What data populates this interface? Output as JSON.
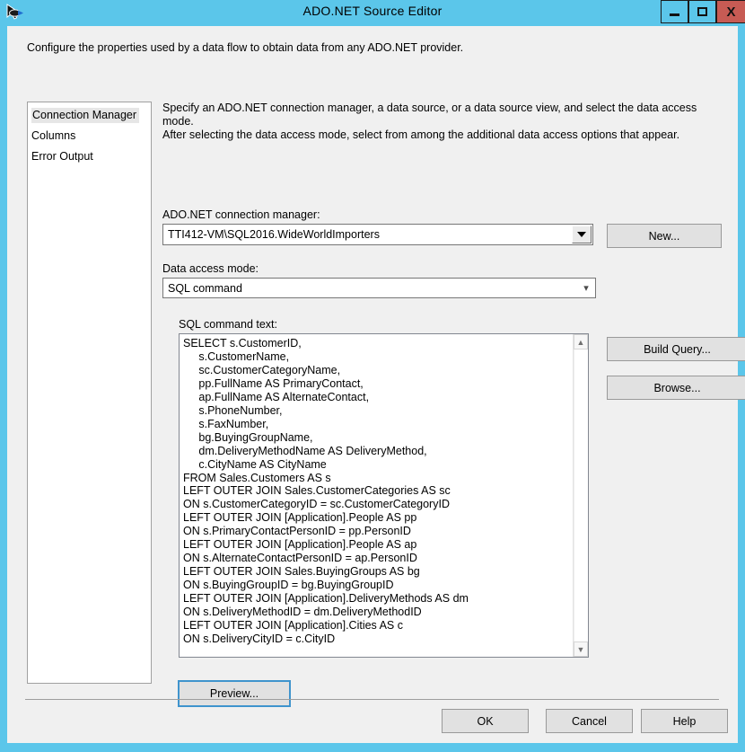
{
  "window": {
    "title": "ADO.NET Source Editor",
    "icon": "ado-net-source-icon",
    "controls": {
      "minimize": "minimize-icon",
      "maximize": "maximize-icon",
      "close": "X"
    },
    "colors": {
      "titlebar": "#5bc6ea",
      "dialog_background": "#f0f0f0",
      "close_button": "#c75b54",
      "focus_outline": "#3f94cd"
    }
  },
  "header": {
    "description": "Configure the properties used by a data flow to obtain data from any ADO.NET provider."
  },
  "nav": {
    "items": [
      {
        "label": "Connection Manager",
        "selected": true
      },
      {
        "label": "Columns",
        "selected": false
      },
      {
        "label": "Error Output",
        "selected": false
      }
    ]
  },
  "content": {
    "description_line1": "Specify an ADO.NET connection manager, a data source, or a data source view, and select the data access mode.",
    "description_line2": "After selecting the data access mode, select from among the additional data access options that appear.",
    "connection_manager": {
      "label": "ADO.NET connection manager:",
      "value": "TTI412-VM\\SQL2016.WideWorldImporters",
      "arrow_icon": "triangle-down-icon",
      "new_button": "New..."
    },
    "data_access_mode": {
      "label": "Data access mode:",
      "value": "SQL command",
      "arrow_icon": "chevron-down-icon"
    },
    "sql_command": {
      "label": "SQL command text:",
      "text": "SELECT s.CustomerID,\n     s.CustomerName,\n     sc.CustomerCategoryName,\n     pp.FullName AS PrimaryContact,\n     ap.FullName AS AlternateContact,\n     s.PhoneNumber,\n     s.FaxNumber,\n     bg.BuyingGroupName,\n     dm.DeliveryMethodName AS DeliveryMethod,\n     c.CityName AS CityName\nFROM Sales.Customers AS s\nLEFT OUTER JOIN Sales.CustomerCategories AS sc\nON s.CustomerCategoryID = sc.CustomerCategoryID\nLEFT OUTER JOIN [Application].People AS pp\nON s.PrimaryContactPersonID = pp.PersonID\nLEFT OUTER JOIN [Application].People AS ap\nON s.AlternateContactPersonID = ap.PersonID\nLEFT OUTER JOIN Sales.BuyingGroups AS bg\nON s.BuyingGroupID = bg.BuyingGroupID\nLEFT OUTER JOIN [Application].DeliveryMethods AS dm\nON s.DeliveryMethodID = dm.DeliveryMethodID\nLEFT OUTER JOIN [Application].Cities AS c\nON s.DeliveryCityID = c.CityID",
      "scrollbar_up_icon": "chevron-up-icon",
      "scrollbar_down_icon": "chevron-down-icon"
    },
    "build_query_button": "Build Query...",
    "browse_button": "Browse...",
    "preview_button": "Preview..."
  },
  "footer": {
    "ok": "OK",
    "cancel": "Cancel",
    "help": "Help"
  }
}
